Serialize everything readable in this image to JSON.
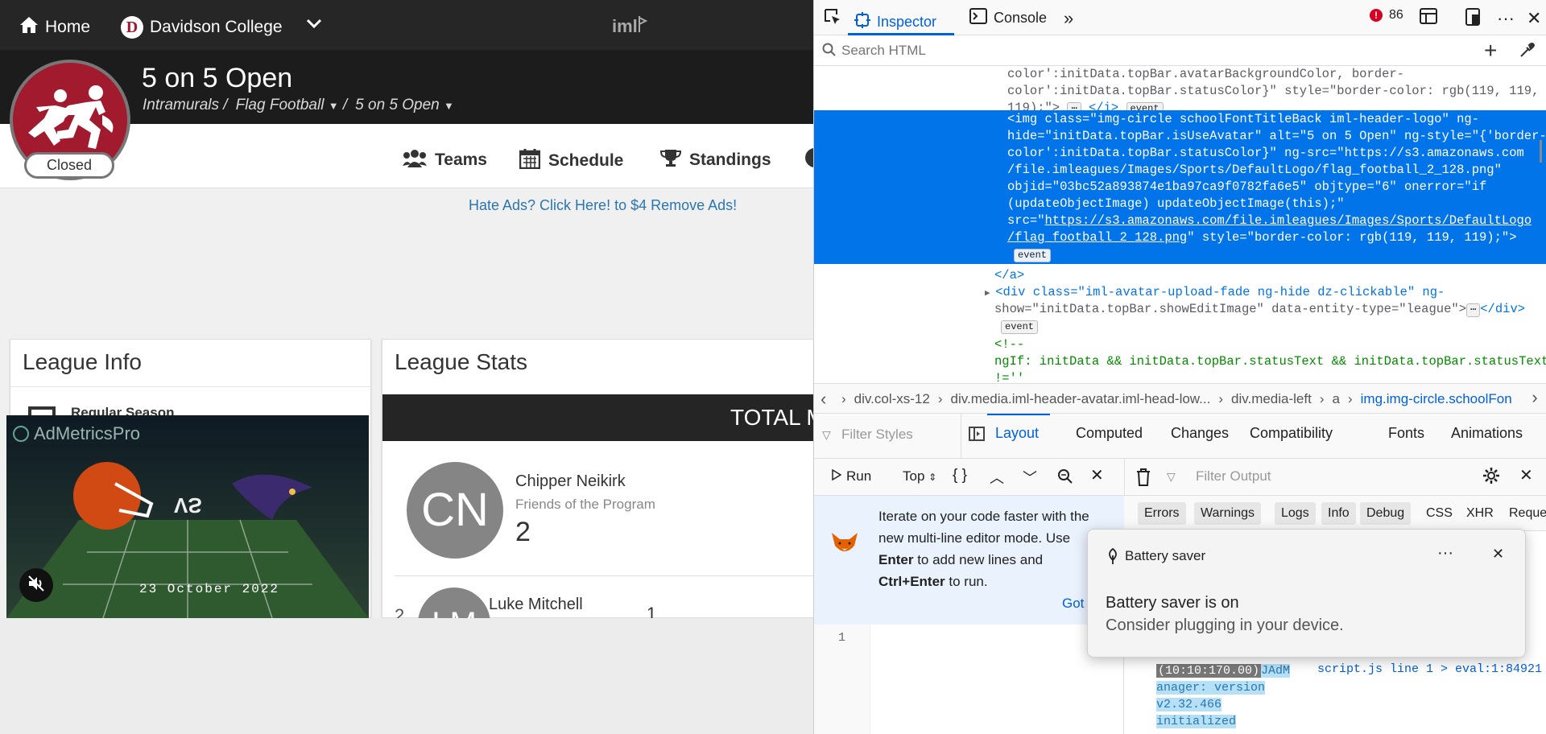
{
  "topnav": {
    "home_label": "Home",
    "college_label": "Davidson College"
  },
  "header": {
    "title": "5 on 5 Open",
    "crumb1": "Intramurals /",
    "crumb2": "Flag Football",
    "crumb3": "5 on 5 Open",
    "status": "Closed"
  },
  "subnav": {
    "teams": "Teams",
    "schedule": "Schedule",
    "standings": "Standings"
  },
  "ads_link": "Hate Ads? Click Here! to $4 Remove Ads!",
  "league_info": {
    "title": "League Info",
    "season": "Regular Season"
  },
  "league_stats": {
    "title": "League Stats",
    "banner": "TOTAL M"
  },
  "players": [
    {
      "initials": "CN",
      "name": "Chipper Neikirk",
      "subtitle": "Friends of the Program",
      "count": "2"
    },
    {
      "rank": "2",
      "initials": "LM",
      "name": "Luke Mitchell",
      "count": "1"
    }
  ],
  "video": {
    "brand": "AdMetricsPro",
    "date": "23 October 2022",
    "mid": "VS"
  },
  "devtools": {
    "tab_inspector": "Inspector",
    "tab_console": "Console",
    "error_count": "86",
    "search_placeholder": "Search HTML",
    "markup": {
      "l0": "color':initData.topBar.avatarBackgroundColor, border-",
      "l1": "color':initData.topBar.statusColor}\" style=\"border-color: rgb(119, 119,",
      "l2": "119);\">",
      "l2b": "</i>",
      "s0": "<img class=\"img-circle schoolFontTitleBack iml-header-logo\" ng-",
      "s1": "hide=\"initData.topBar.isUseAvatar\" alt=\"5 on 5 Open\" ng-style=\"{'border-",
      "s2": "color':initData.topBar.statusColor}\" ng-src=\"https://s3.amazonaws.com",
      "s3": "/file.imleagues/Images/Sports/DefaultLogo/flag_football_2_128.png\"",
      "s4": "objid=\"03bc52a893874e1ba97ca9f0782fa6e5\" objtype=\"6\" onerror=\"if",
      "s5": "(updateObjectImage) updateObjectImage(this);\"",
      "s6a": "src=\"",
      "s6b": "https://s3.amazonaws.com/file.imleagues/Images/Sports/DefaultLogo",
      "s7a": "/flag_football_2_128.png",
      "s7b": "\" style=\"border-color: rgb(119, 119, 119);\">",
      "event": "event",
      "a_close": "</a>",
      "d0a": "<div class=\"iml-avatar-upload-fade ng-hide dz-clickable\" ng-",
      "d1a": "show=\"initData.topBar.showEditImage\" data-entity-type=\"league\">",
      "d1b": "</div>",
      "c0": "<!--",
      "c1": "ngIf: initData && initData.topBar.statusText && initData.topBar.statusText",
      "c2": "!=''"
    },
    "crumbs": [
      "div.col-xs-12",
      "div.media.iml-header-avatar.iml-head-low...",
      "div.media-left",
      "a",
      "img.img-circle.schoolFon"
    ],
    "filter_styles": "Filter Styles",
    "rule_tabs": [
      "Layout",
      "Computed",
      "Changes",
      "Compatibility",
      "Fonts",
      "Animations"
    ],
    "console": {
      "run": "Run",
      "top": "Top",
      "filter_output": "Filter Output",
      "filters": [
        "Errors",
        "Warnings",
        "Logs",
        "Info",
        "Debug"
      ],
      "extra": [
        "CSS",
        "XHR",
        "Requests"
      ],
      "tip_line1": "Iterate on your code faster with the",
      "tip_line2": "new multi-line editor mode. Use",
      "tip_enter": "Enter",
      "tip_line3": " to add new lines and",
      "tip_ctrl": "Ctrl+Enter",
      "tip_line4": " to run.",
      "got_it": "Got",
      "line_no": "1",
      "log_time": "(10:10:170.00)",
      "log_name": "JAdM",
      "log_src": "script.js line 1 > eval:1:84921",
      "log_l2": "anager: version",
      "log_l3": "v2.32.466",
      "log_l4": "initialized"
    }
  },
  "toast": {
    "title": "Battery saver",
    "heading": "Battery saver is on",
    "body": "Consider plugging in your device.",
    "more": "···"
  }
}
